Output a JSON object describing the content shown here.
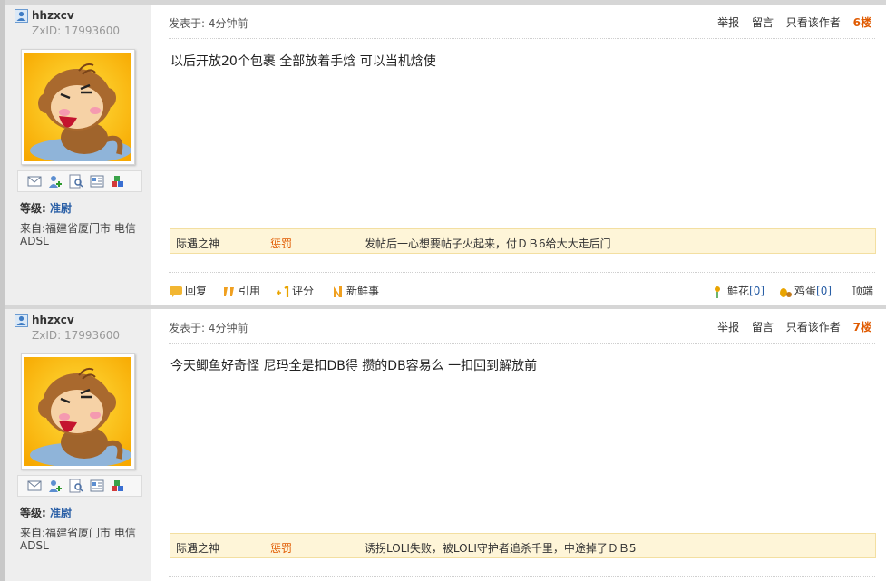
{
  "posts": [
    {
      "username": "hhzxcv",
      "zxid": "ZxID:  17993600",
      "level_label": "等级:",
      "level_value": "准尉",
      "location": "来自:福建省厦门市 电信ADSL",
      "posted": "发表于: 4分钟前",
      "actions": {
        "report": "举报",
        "message": "留言",
        "author_only": "只看该作者",
        "floor": "6楼"
      },
      "content": "以后开放20个包裹  全部放着手焓  可以当机焓使",
      "rating": {
        "rater": "际遇之神",
        "type": "惩罚",
        "reason": "发帖后一心想要帖子火起来，付ＤＢ6给大大走后门"
      },
      "footer": {
        "reply": "回复",
        "quote": "引用",
        "rate": "评分",
        "fresh": "新鲜事",
        "flower": "鲜花",
        "flower_count": "[0]",
        "egg": "鸡蛋",
        "egg_count": "[0]",
        "top": "顶端"
      }
    },
    {
      "username": "hhzxcv",
      "zxid": "ZxID:  17993600",
      "level_label": "等级:",
      "level_value": "准尉",
      "location": "来自:福建省厦门市 电信ADSL",
      "posted": "发表于: 4分钟前",
      "actions": {
        "report": "举报",
        "message": "留言",
        "author_only": "只看该作者",
        "floor": "7楼"
      },
      "content": "今天鲫鱼好奇怪  尼玛全是扣DB得 攒的DB容易么  一扣回到解放前",
      "rating": {
        "rater": "际遇之神",
        "type": "惩罚",
        "reason": "诱拐LOLI失败，被LOLI守护者追杀千里，中途掉了ＤＢ5"
      }
    }
  ],
  "colors": {
    "floor": "#e05a00",
    "level": "#2a5fa6",
    "rating_bg": "#fef5d8",
    "sidebar_bg": "#eeeeee"
  }
}
